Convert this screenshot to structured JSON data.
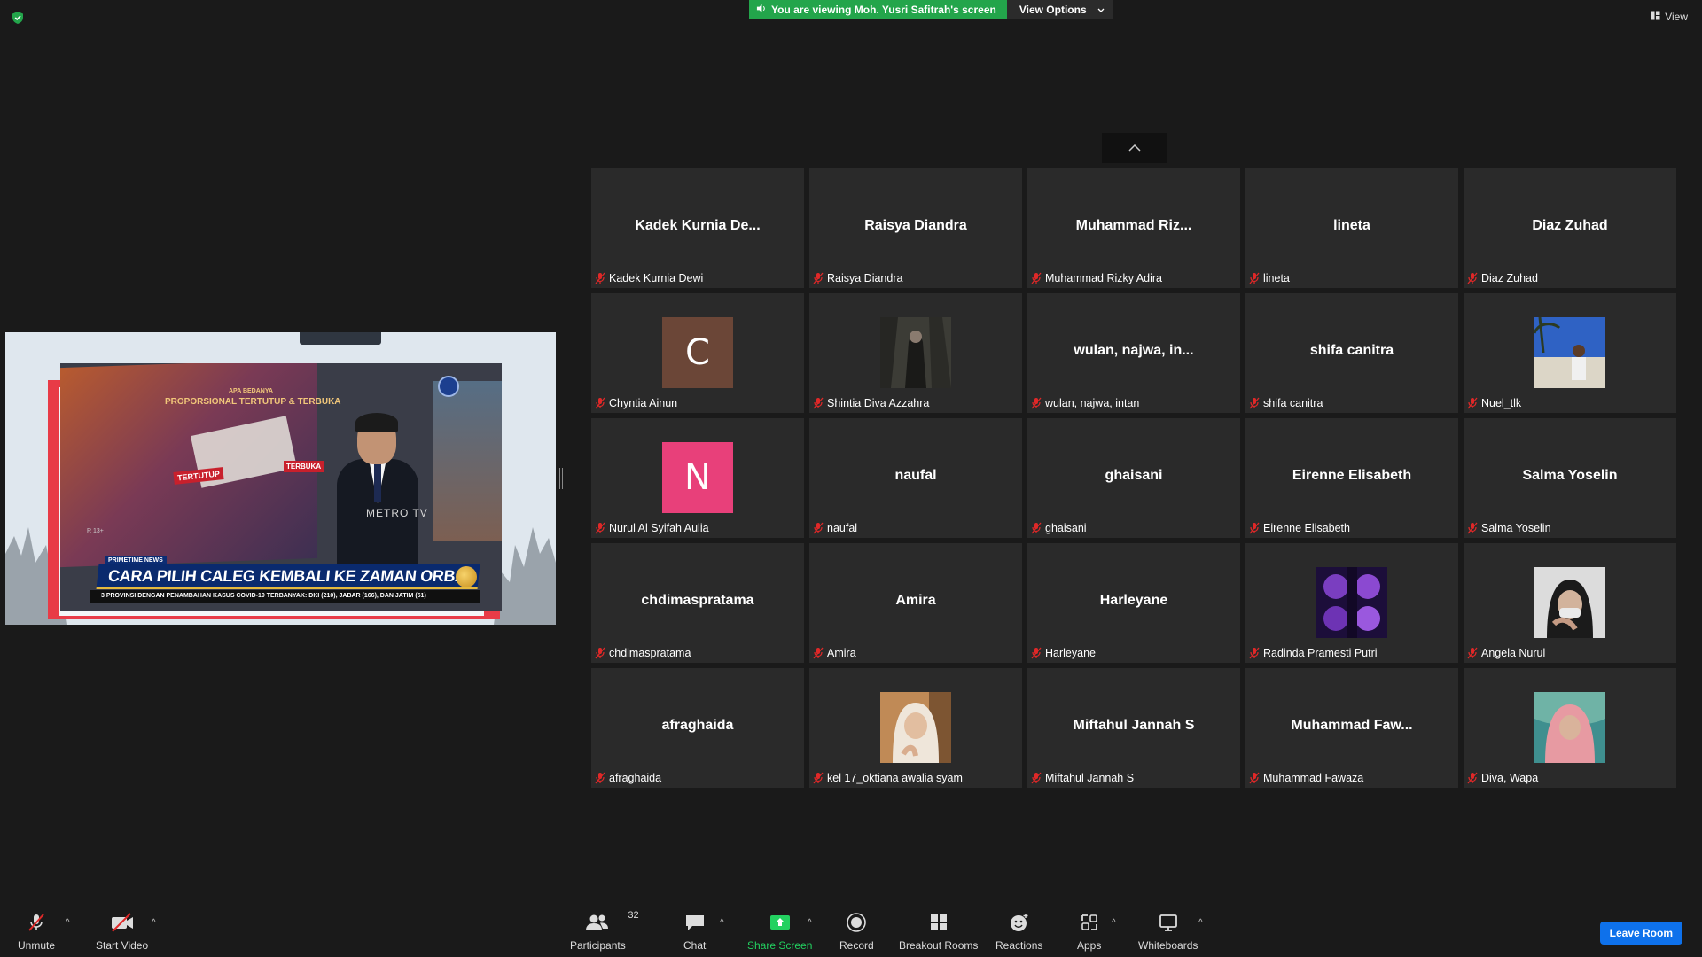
{
  "top_bar": {
    "banner_text": "You are viewing Moh. Yusri Safitrah's screen",
    "view_options_label": "View Options",
    "view_label": "View"
  },
  "shared_screen": {
    "screen_title": "PROPORSIONAL TERTUTUP & TERBUKA",
    "screen_subtitle": "APA BEDANYA",
    "tertutup_label": "TERTUTUP",
    "terbuka_label": "TERBUKA",
    "rating": "R 13+",
    "watermark": "METRO TV",
    "news_tag": "PRIMETIME NEWS",
    "headline": "CARA PILIH CALEG KEMBALI KE ZAMAN ORBA?",
    "ticker": "3 PROVINSI DENGAN PENAMBAHAN KASUS COVID-19 TERBANYAK: DKI (210), JABAR (166), DAN JATIM (51)"
  },
  "participants": [
    {
      "big_name": "Kadek  Kurnia  De...",
      "label": "Kadek Kurnia Dewi"
    },
    {
      "big_name": "Raisya Diandra",
      "label": "Raisya Diandra"
    },
    {
      "big_name": "Muhammad  Riz...",
      "label": "Muhammad Rizky Adira"
    },
    {
      "big_name": "lineta",
      "label": "lineta"
    },
    {
      "big_name": "Diaz Zuhad",
      "label": "Diaz Zuhad"
    },
    {
      "avatar_letter": "C",
      "avatar_color": "#6b4637",
      "label": "Chyntia Ainun"
    },
    {
      "photo": "forest-person",
      "label": "Shintia Diva Azzahra"
    },
    {
      "big_name": "wulan,  najwa,  in...",
      "label": "wulan, najwa, intan"
    },
    {
      "big_name": "shifa canitra",
      "label": "shifa canitra"
    },
    {
      "photo": "beach-person",
      "label": "Nuel_tlk"
    },
    {
      "avatar_letter": "N",
      "avatar_color": "#e8407a",
      "label": "Nurul Al Syifah Aulia"
    },
    {
      "big_name": "naufal",
      "label": "naufal"
    },
    {
      "big_name": "ghaisani",
      "label": "ghaisani"
    },
    {
      "big_name": "Eirenne Elisabeth",
      "label": "Eirenne Elisabeth"
    },
    {
      "big_name": "Salma Yoselin",
      "label": "Salma Yoselin"
    },
    {
      "big_name": "chdimaspratama",
      "label": "chdimaspratama"
    },
    {
      "big_name": "Amira",
      "label": "Amira"
    },
    {
      "big_name": "Harleyane",
      "label": "Harleyane"
    },
    {
      "photo": "purple-faces",
      "label": "Radinda Pramesti Putri"
    },
    {
      "photo": "masked-person",
      "label": "Angela Nurul"
    },
    {
      "big_name": "afraghaida",
      "label": "afraghaida"
    },
    {
      "photo": "hijab-person",
      "label": "kel 17_oktiana awalia syam"
    },
    {
      "big_name": "Miftahul Jannah S",
      "label": "Miftahul Jannah S"
    },
    {
      "big_name": "Muhammad  Faw...",
      "label": "Muhammad Fawaza"
    },
    {
      "photo": "pink-hijab-person",
      "label": "Diva, Wapa"
    }
  ],
  "toolbar": {
    "unmute": "Unmute",
    "start_video": "Start Video",
    "participants": "Participants",
    "participants_count": "32",
    "chat": "Chat",
    "share_screen": "Share Screen",
    "record": "Record",
    "breakout_rooms": "Breakout Rooms",
    "reactions": "Reactions",
    "apps": "Apps",
    "whiteboards": "Whiteboards",
    "leave_room": "Leave Room"
  },
  "colors": {
    "banner_green": "#23a54b",
    "leave_blue": "#0e71eb",
    "mic_off_red": "#e02828"
  }
}
